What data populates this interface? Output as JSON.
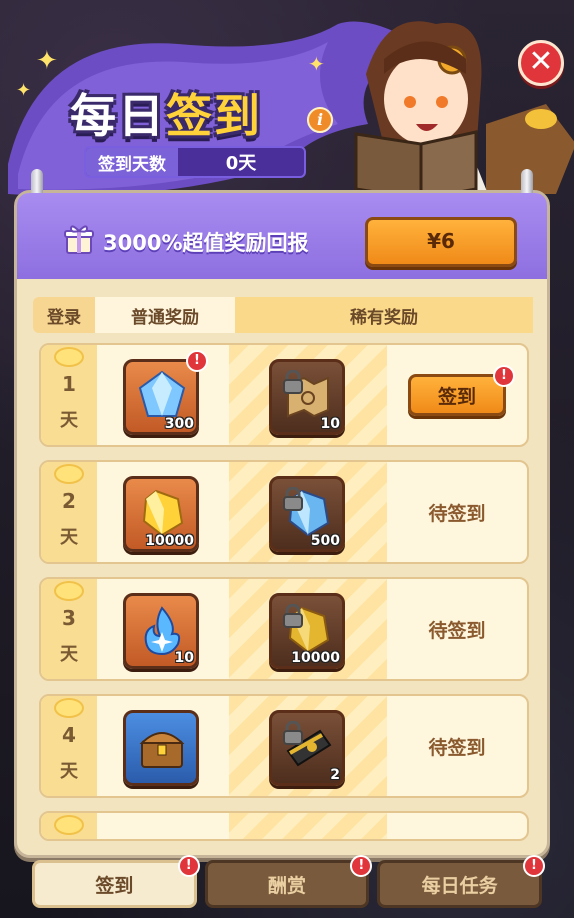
{
  "header": {
    "title_part1": "每日",
    "title_part2": "签到",
    "days_label": "签到天数",
    "days_value": "0天"
  },
  "promo": {
    "text": "3000%超值奖励回报",
    "price": "¥6"
  },
  "columns": {
    "login": "登录",
    "normal": "普通奖励",
    "rare": "稀有奖励"
  },
  "rows": [
    {
      "day": "1",
      "unit": "天",
      "normal_qty": "300",
      "normal_icon": "blue-gem-icon",
      "rare_qty": "10",
      "rare_icon": "treasure-map-icon",
      "status": "签到"
    },
    {
      "day": "2",
      "unit": "天",
      "normal_qty": "10000",
      "normal_icon": "gold-gem-icon",
      "rare_qty": "500",
      "rare_icon": "blue-gem-icon",
      "status": "待签到"
    },
    {
      "day": "3",
      "unit": "天",
      "normal_qty": "10",
      "normal_icon": "blue-flame-icon",
      "rare_qty": "10000",
      "rare_icon": "gold-gem-icon",
      "status": "待签到"
    },
    {
      "day": "4",
      "unit": "天",
      "normal_qty": "",
      "normal_icon": "treasure-chest-icon",
      "rare_qty": "2",
      "rare_icon": "scroll-icon",
      "status": "待签到"
    }
  ],
  "tabs": [
    {
      "label": "签到",
      "active": true
    },
    {
      "label": "酬赏",
      "active": false
    },
    {
      "label": "每日任务",
      "active": false
    }
  ],
  "colors": {
    "accent": "#f08a18",
    "panel": "#f3e4c0",
    "header_purple": "#8e6fe0",
    "alert": "#e0353a"
  }
}
